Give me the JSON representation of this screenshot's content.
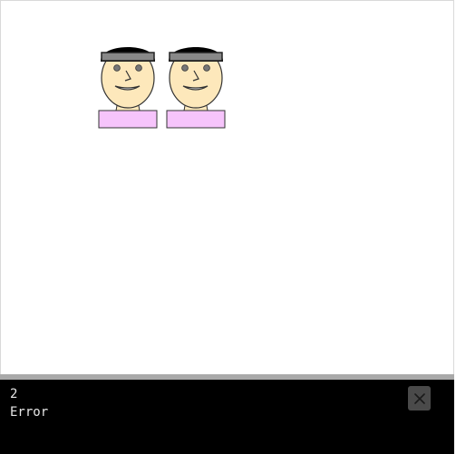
{
  "stage": {
    "sprites": [
      {
        "name": "character-1"
      },
      {
        "name": "character-2"
      }
    ]
  },
  "console": {
    "lines": [
      "2",
      "Error"
    ]
  },
  "colors": {
    "skin": "#fde8bb",
    "hair": "#000000",
    "headband": "#888888",
    "shirt": "#f6c4fb",
    "console_bg": "#000000",
    "console_text": "#e6e6e6",
    "divider": "#a9a9a9",
    "close_button_bg": "#4a4a4a"
  },
  "icons": {
    "close": "close-icon"
  }
}
